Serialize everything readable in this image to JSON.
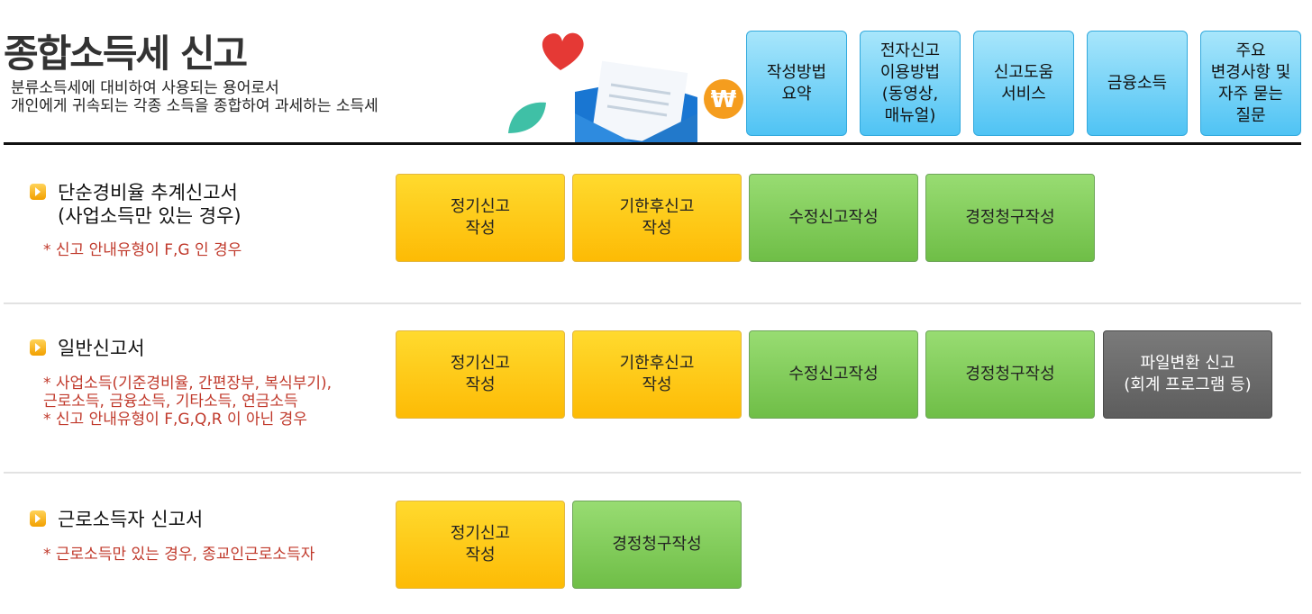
{
  "header": {
    "title": "종합소득세 신고",
    "desc_line1": "분류소득세에 대비하여 사용되는 용어로서",
    "desc_line2": "개인에게 귀속되는 각종 소득을 종합하여 과세하는 소득세",
    "illustration_icons": [
      "heart-icon",
      "leaf-icon",
      "envelope-icon",
      "won-coin-icon"
    ]
  },
  "top_menu": [
    {
      "label": "작성방법\n요약"
    },
    {
      "label": "전자신고\n이용방법\n(동영상,\n매뉴얼)"
    },
    {
      "label": "신고도움\n서비스"
    },
    {
      "label": "금융소득"
    },
    {
      "label": "주요\n변경사항 및\n자주 묻는\n질문"
    }
  ],
  "sections": [
    {
      "title": "단순경비율 추계신고서\n(사업소득만 있는 경우)",
      "note": "* 신고 안내유형이 F,G 인 경우",
      "buttons": [
        {
          "label": "정기신고\n작성"
        },
        {
          "label": "기한후신고\n작성"
        },
        {
          "label": "수정신고작성"
        },
        {
          "label": "경정청구작성"
        }
      ]
    },
    {
      "title": "일반신고서",
      "note": "* 사업소득(기준경비율, 간편장부, 복식부기),\n  근로소득, 금융소득, 기타소득, 연금소득\n* 신고 안내유형이 F,G,Q,R 이 아닌 경우",
      "buttons": [
        {
          "label": "정기신고\n작성"
        },
        {
          "label": "기한후신고\n작성"
        },
        {
          "label": "수정신고작성"
        },
        {
          "label": "경정청구작성"
        },
        {
          "label": "파일변환 신고\n(회계 프로그램 등)"
        }
      ]
    },
    {
      "title": "근로소득자 신고서",
      "note": "* 근로소득만 있는 경우, 종교인근로소득자",
      "buttons": [
        {
          "label": "정기신고\n작성"
        },
        {
          "label": "경정청구작성"
        }
      ]
    }
  ],
  "colors": {
    "top_button": "#4fc3f4",
    "yellow_button": "#fdbb05",
    "green_button": "#6fbe47",
    "gray_button": "#5d5d5d",
    "note_text": "#c0392b"
  }
}
